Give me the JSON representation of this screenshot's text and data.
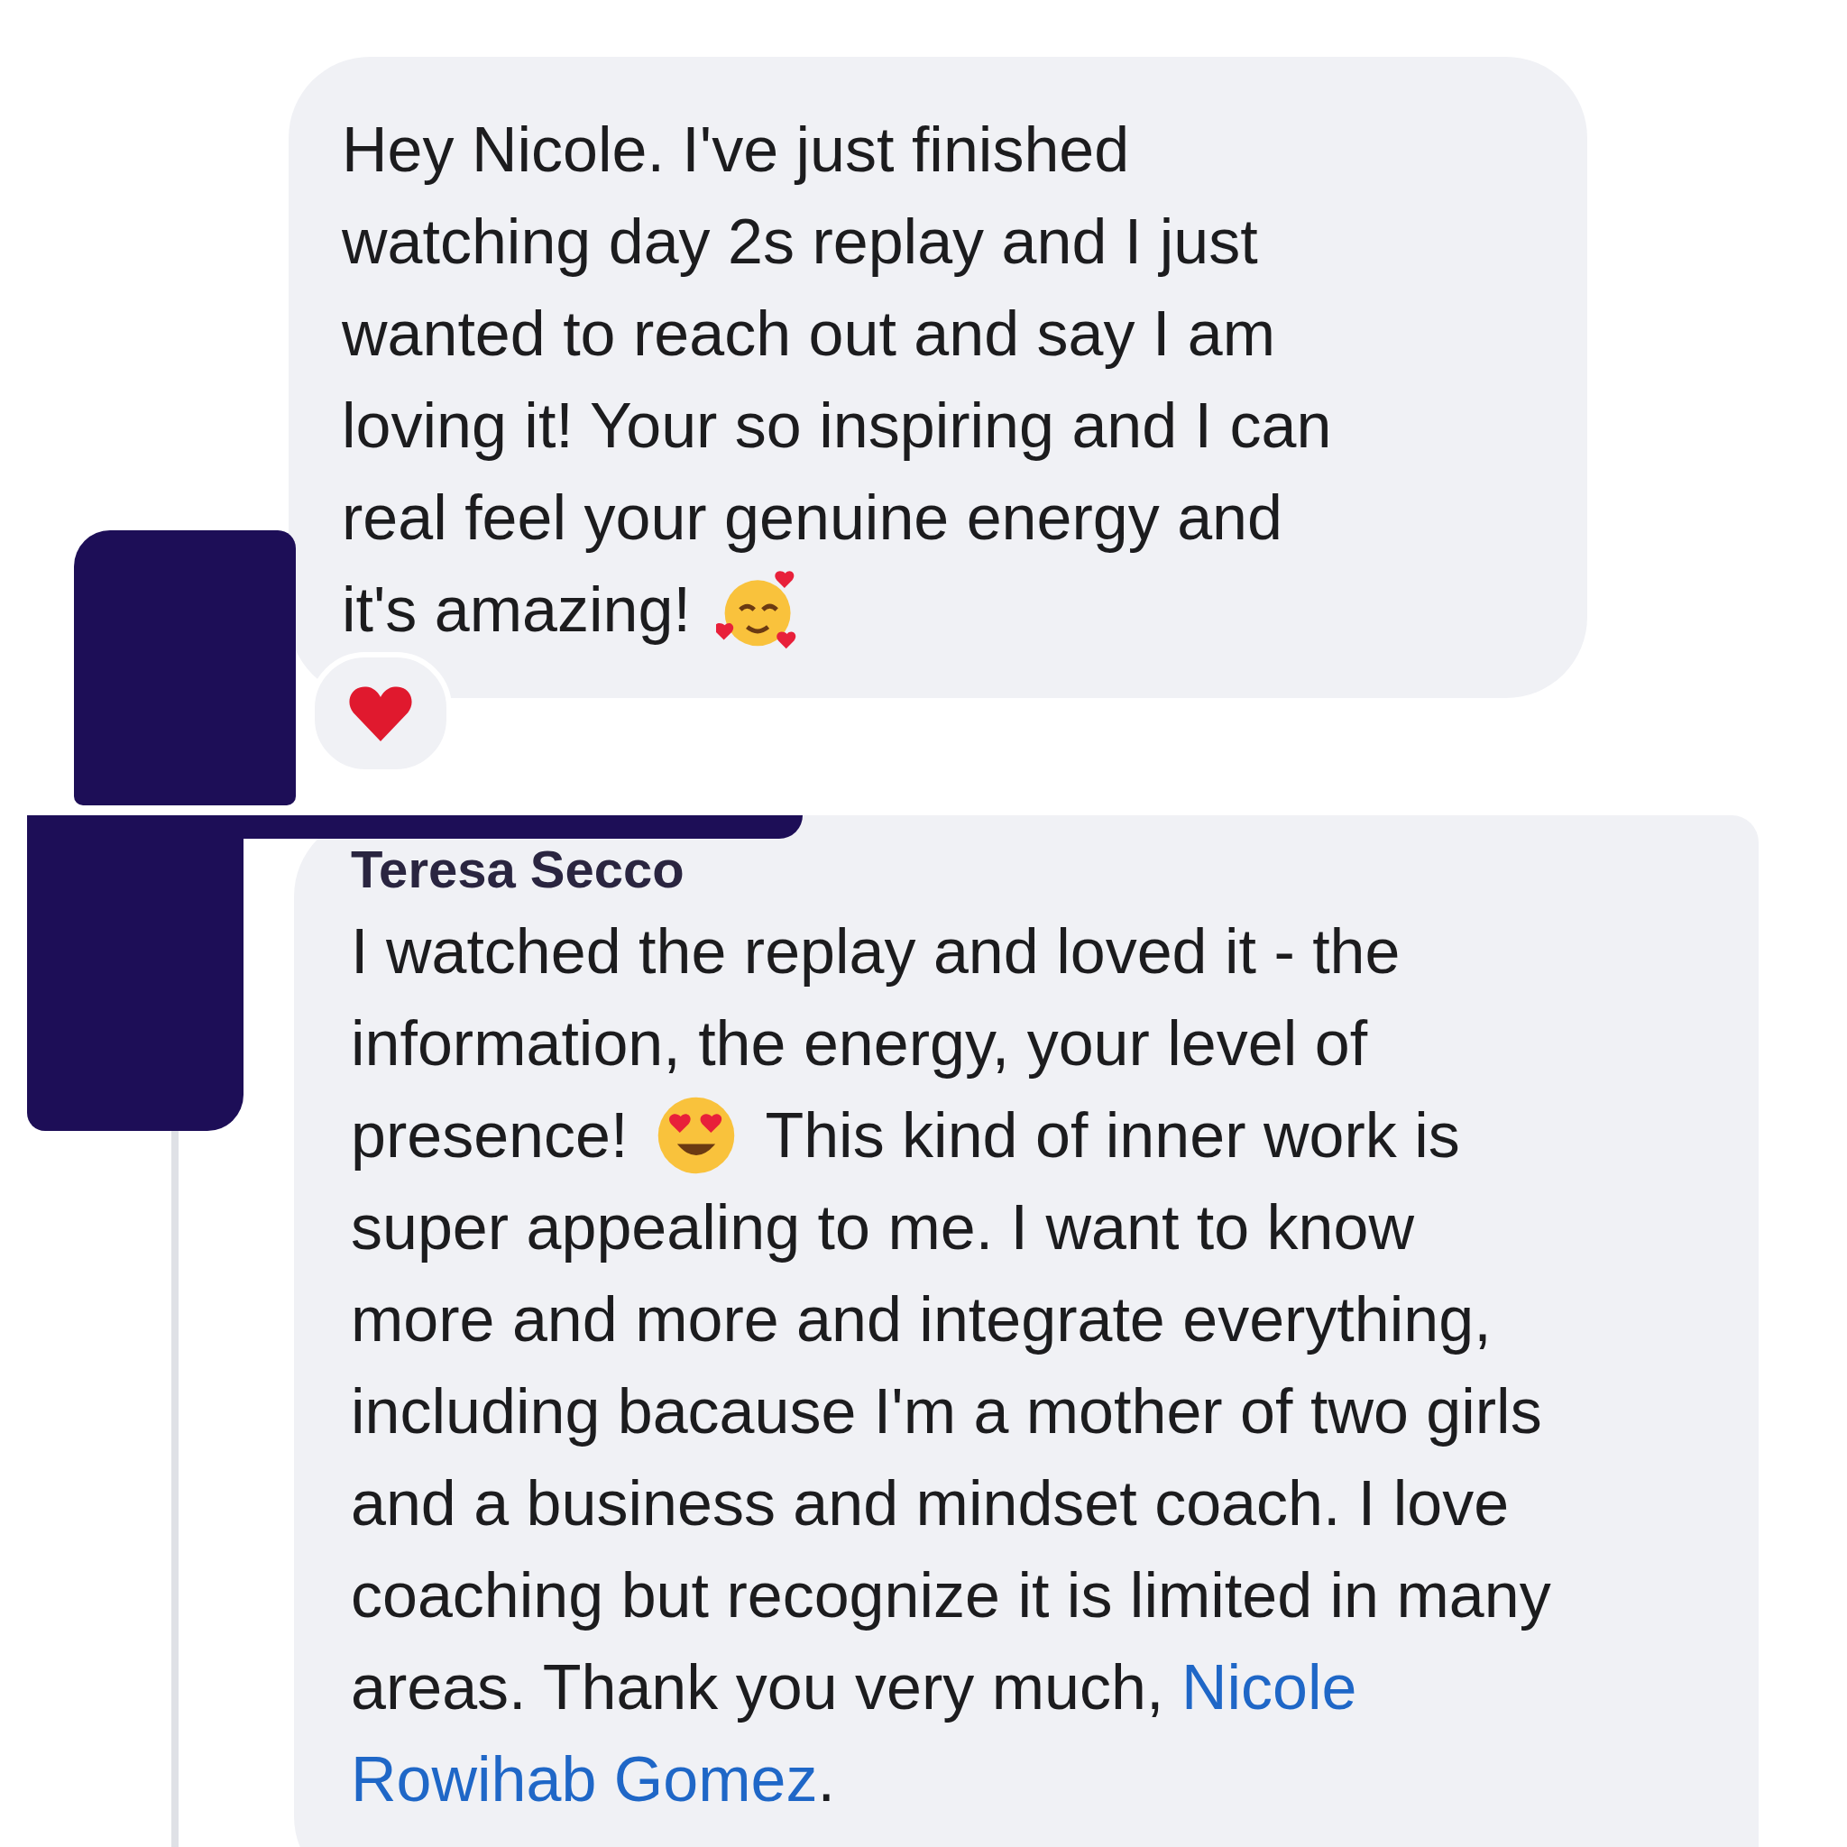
{
  "messages": [
    {
      "kind": "own",
      "reacted_heart": true,
      "lines": [
        [
          {
            "kind": "text",
            "text": "Hey Nicole. I've just finished"
          }
        ],
        [
          {
            "kind": "text",
            "text": "watching day 2s replay and I just"
          }
        ],
        [
          {
            "kind": "text",
            "text": "wanted to reach out and say I am"
          }
        ],
        [
          {
            "kind": "text",
            "text": "loving it! Your so inspiring and I can"
          }
        ],
        [
          {
            "kind": "text",
            "text": "real feel your genuine energy and"
          }
        ],
        [
          {
            "kind": "text",
            "text": "it's amazing!"
          },
          {
            "kind": "emoji_hearts"
          }
        ]
      ]
    },
    {
      "kind": "reply",
      "author": "Teresa Secco",
      "lines": [
        [
          {
            "kind": "text",
            "text": "I watched the replay and loved it - the"
          }
        ],
        [
          {
            "kind": "text",
            "text": "information, the energy, your level of"
          }
        ],
        [
          {
            "kind": "text",
            "text": "presence!"
          },
          {
            "kind": "emoji_heart_eyes"
          },
          {
            "kind": "text",
            "text": "This kind of inner work is"
          }
        ],
        [
          {
            "kind": "text",
            "text": "super appealing to me. I want to know"
          }
        ],
        [
          {
            "kind": "text",
            "text": "more and more and integrate everything,"
          }
        ],
        [
          {
            "kind": "text",
            "text": "including bacause I'm a mother of two girls"
          }
        ],
        [
          {
            "kind": "text",
            "text": "and a business and mindset coach. I love"
          }
        ],
        [
          {
            "kind": "text",
            "text": "coaching but recognize it is limited in many"
          }
        ],
        [
          {
            "kind": "text",
            "text": "areas. Thank you very much,"
          },
          {
            "kind": "link",
            "text": "Nicole"
          }
        ],
        [
          {
            "kind": "link",
            "text": "Rowihab Gomez"
          },
          {
            "kind": "text",
            "text": "."
          }
        ]
      ]
    }
  ]
}
